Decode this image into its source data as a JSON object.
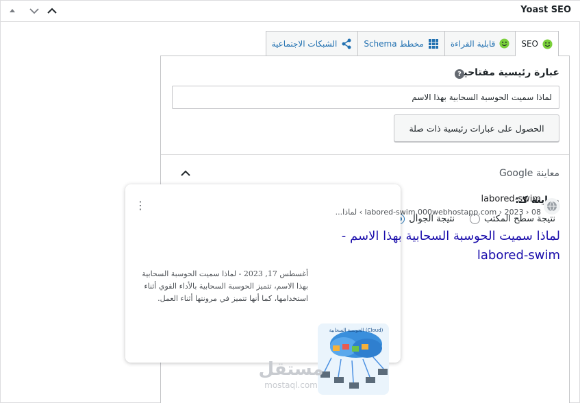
{
  "header": {
    "title": "Yoast SEO",
    "move_up": "▲",
    "move_down": "⌄",
    "collapse": "⌃"
  },
  "tabs": [
    {
      "label": "SEO",
      "icon": "smiley-icon",
      "color": "#7ad03a"
    },
    {
      "label": "قابلية القراءة",
      "icon": "smiley-icon",
      "color": "#7ad03a"
    },
    {
      "label": "مخطط Schema",
      "icon": "grid-icon",
      "color": "#2271b1"
    },
    {
      "label": "الشبكات الاجتماعية",
      "icon": "share-icon",
      "color": "#2271b1"
    }
  ],
  "focus_keyphrase": {
    "title": "عبارة رئيسية مفتاحية",
    "value": "لماذا سميت الحوسبة السحابية بهذا الاسم",
    "related_button": "الحصول على عبارات رئيسية ذات صلة"
  },
  "google_preview": {
    "title": "معاينة Google",
    "preview_as": "معاينة كـ:",
    "options": [
      {
        "label": "نتيجة الجوال",
        "checked": true
      },
      {
        "label": "نتيجة سطح المكتب",
        "checked": false
      }
    ],
    "site_name": "labored-swim",
    "url": "labored-swim.000webhostapp.com › 2023 › 08 › لماذا...",
    "result_title": "لماذا سميت الحوسبة السحابية بهذا الاسم - labored-swim",
    "date": "أغسطس 17, 2023",
    "separator": "-",
    "snippet": "لماذا سميت الحوسبة السحابية بهذا الاسم، تتميز الحوسبة السحابية بالأداء القوي أثناء استخدامها، كما أنها تتميز في مرونتها أثناء العمل.",
    "thumb_text": "الحوسبة السحابية (Cloud)"
  },
  "watermark": {
    "arabic": "مستقل",
    "latin": "mostaql.com"
  },
  "colors": {
    "link": "#1a0dab",
    "wp_blue": "#2271b1",
    "green": "#7ad03a"
  }
}
